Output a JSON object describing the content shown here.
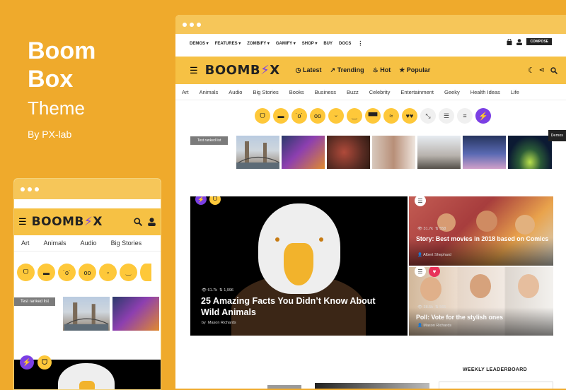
{
  "hero": {
    "title_line1": "Boom",
    "title_line2": "Box",
    "subtitle": "Theme",
    "byline": "By PX-lab"
  },
  "topnav": {
    "items": [
      "DEMOS ▾",
      "FEATURES ▾",
      "ZOMBIFY ▾",
      "GAMIFY ▾",
      "SHOP ▾",
      "BUY",
      "DOCS"
    ],
    "compose": "COMPOSE"
  },
  "logo": {
    "part1": "BOOMB",
    "bolt": "⚡",
    "part2": "X"
  },
  "mainnav": {
    "latest": "Latest",
    "trending": "Trending",
    "hot": "Hot",
    "popular": "Popular"
  },
  "categories": [
    "Art",
    "Animals",
    "Audio",
    "Big Stories",
    "Books",
    "Business",
    "Buzz",
    "Celebrity",
    "Entertainment",
    "Geeky",
    "Health Ideas",
    "Life"
  ],
  "ranked_label": "Test ranked list",
  "feature": {
    "title": "25 Amazing Facts You Didn’t Know About Wild Animals",
    "views": "61.7k",
    "shares": "1,996",
    "author_prefix": "by",
    "author": "Mason Richards"
  },
  "side1": {
    "title": "Story: Best movies in 2018 based on Comics",
    "views": "31.7k",
    "shares": "558",
    "author": "Albert Shephard"
  },
  "side2": {
    "title": "Poll: Vote for the stylish ones",
    "views": "38.5k",
    "shares": "565",
    "author": "Mason Richards"
  },
  "demos_tab": "Demos",
  "leaderboard": "WEEKLY LEADERBOARD",
  "mobile": {
    "categories": [
      "Art",
      "Animals",
      "Audio",
      "Big Stories"
    ],
    "ranked_label": "Test ranked list"
  },
  "colors": {
    "background": "#efaa2c",
    "bar": "#f6c144",
    "accent": "#7b3fe4",
    "emoji": "#fec83a"
  }
}
